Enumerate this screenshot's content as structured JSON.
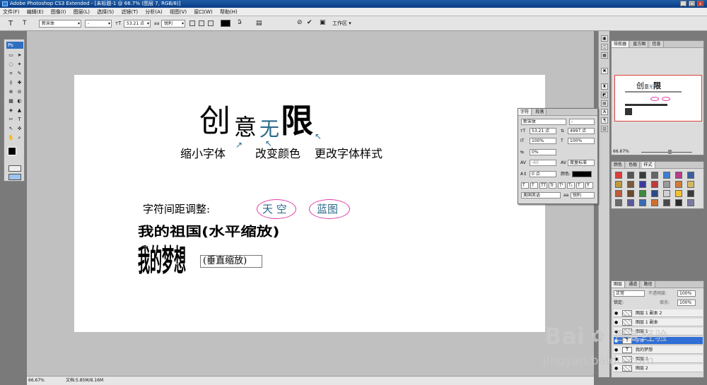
{
  "window": {
    "title": "Adobe Photoshop CS3 Extended - [未标题-1 @ 66.7% (图层 7, RGB/8)]",
    "min_label": "_",
    "max_label": "□",
    "close_label": "x"
  },
  "menu": [
    "文件(F)",
    "编辑(E)",
    "图像(I)",
    "图层(L)",
    "选择(S)",
    "滤镜(T)",
    "分析(A)",
    "视图(V)",
    "窗口(W)",
    "帮助(H)"
  ],
  "options": {
    "tool_letter": "T",
    "orient_letter": "T",
    "font_family": "新宋体",
    "font_style": "-",
    "font_size": "53.21 点",
    "aa_label": "aa",
    "aa_mode": "锐利",
    "workspace": "工作区"
  },
  "toolbox": {
    "logo": "Ps",
    "tools": [
      "▭",
      "➤",
      "◌",
      "✦",
      "⌗",
      "✎",
      "⟠",
      "✚",
      "⊕",
      "⊘",
      "▦",
      "◐",
      "◈",
      "▲",
      "✂",
      "T",
      "↖",
      "✜",
      "✋",
      "⌕"
    ]
  },
  "canvas": {
    "headline_1": "创",
    "headline_2": "意",
    "headline_3": "无",
    "headline_4": "限",
    "label_shrink": "缩小字体",
    "label_color": "改变颜色",
    "label_style": "更改字体样式",
    "spacing_label": "字符间距调整:",
    "ellipse_1": "天 空",
    "ellipse_2": "蓝图",
    "horizontal_scale": "我的祖国(水平缩放)",
    "vertical_scale": "我的梦想",
    "vertical_note": "(垂直缩放)",
    "accent_color": "#2b6a8a",
    "ellipse_color": "#e03aa9"
  },
  "status": {
    "zoom": "66.67%",
    "doc_info": "文档:5.85M/8.16M"
  },
  "char_panel": {
    "tabs": [
      "字符",
      "段落"
    ],
    "font_family": "新宋体",
    "font_style": "-",
    "size": "53.21 点",
    "leading": "4997 点",
    "vscale": "100%",
    "hscale": "100%",
    "tracking": "0%",
    "kerning_auto": "-60",
    "kerning_metric": "度量标准",
    "baseline": "0 点",
    "color_label": "颜色:",
    "styles": [
      "T",
      "T",
      "TT",
      "Tr",
      "T¹",
      "T₁",
      "T",
      "Ŧ"
    ],
    "language": "美国英语",
    "aa_label": "aa",
    "aa_mode": "锐利"
  },
  "navigator": {
    "tabs": [
      "导航器",
      "直方图",
      "信息"
    ],
    "zoom": "66.67%"
  },
  "swatches": {
    "tabs": [
      "颜色",
      "色板",
      "样式"
    ],
    "colors": [
      "#e23a3a",
      "#555555",
      "#3a3a3a",
      "#666666",
      "#3a7fd0",
      "#b83a8a",
      "#3a5fa0",
      "#c09a3a",
      "#7a5a3a",
      "#3a3aa0",
      "#c03a3a",
      "#999999",
      "#d07a3a",
      "#d4b860",
      "#c05a3a",
      "#6a4a2a",
      "#3a8a3a",
      "#2a4a8a",
      "#d0d0d0",
      "#f0c030",
      "#3a3a3a",
      "#6a6a6a",
      "#5a5a9a",
      "#3a6ab0",
      "#d07030",
      "#4a4a4a",
      "#2a2a2a",
      "#7a7aa0"
    ]
  },
  "layers": {
    "tabs": [
      "图层",
      "通道",
      "路径"
    ],
    "blend": "正常",
    "opacity_label": "不透明度:",
    "opacity": "100%",
    "lock_label": "锁定:",
    "fill_label": "填充:",
    "fill": "100%",
    "items": [
      {
        "name": "图层 1 副本 2",
        "type": "raster"
      },
      {
        "name": "图层 1 副本",
        "type": "raster"
      },
      {
        "name": "图层 1",
        "type": "raster"
      },
      {
        "name": "字体",
        "type": "text"
      },
      {
        "name": "我的梦想",
        "type": "text"
      },
      {
        "name": "图层 3",
        "type": "raster"
      },
      {
        "name": "图层 2",
        "type": "raster"
      }
    ]
  },
  "watermark": {
    "brand": "Bai",
    "brand2": "百度",
    "brand3": "经验",
    "url": "jingyan.baidu.com"
  }
}
